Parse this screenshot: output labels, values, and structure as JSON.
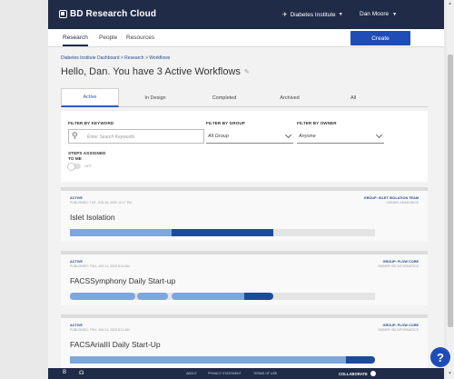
{
  "header": {
    "app_name": "BD Research Cloud",
    "org_name": "Diabetes Institute",
    "user_name": "Dan Moore"
  },
  "nav": {
    "items": [
      {
        "label": "Research"
      },
      {
        "label": "People"
      },
      {
        "label": "Resources"
      }
    ],
    "create_label": "Create"
  },
  "breadcrumb": "Diabetes Institute Dashboard  >  Research  >  Workflows",
  "headline": "Hello, Dan. You have 3 Active Workflows",
  "tabs": [
    {
      "label": "Active"
    },
    {
      "label": "In Design"
    },
    {
      "label": "Completed"
    },
    {
      "label": "Archived"
    },
    {
      "label": "All"
    }
  ],
  "filters": {
    "keyword_label": "FILTER BY KEYWORD",
    "keyword_placeholder": "Enter Search Keywords",
    "group_label": "FILTER BY GROUP",
    "group_value": "All Group",
    "owner_label": "FILTER BY OWNER",
    "owner_value": "Anyone",
    "steps_label_1": "STEPS ASSIGNED",
    "steps_label_2": "TO ME",
    "toggle_label": "OFF",
    "toggle_on": false
  },
  "workflows": [
    {
      "status": "ACTIVE",
      "published": "PUBLISHED: TUE, JUN 16, 2020 12:17 PM",
      "group": "GROUP: ISLET ISOLATION TEAM",
      "owner": "OWNER: ADAM BECK",
      "name": "Islet Isolation"
    },
    {
      "status": "ACTIVE",
      "published": "PUBLISHED: THU, JUN 11, 2020 8:44 AM",
      "group": "GROUP: FLOW CORE",
      "owner": "OWNER: BD INFORMATICS",
      "name": "FACSSymphony Daily Start-up"
    },
    {
      "status": "ACTIVE",
      "published": "PUBLISHED: THU, JUN 11, 2020 8:11 AM",
      "group": "GROUP: FLOW CORE",
      "owner": "OWNER: BD INFORMATICS",
      "name": "FACSAriaIII Daily Start-Up"
    }
  ],
  "footer": {
    "links": [
      {
        "label": "ABOUT"
      },
      {
        "label": "PRIVACY STATEMENT"
      },
      {
        "label": "TERMS OF USE"
      }
    ],
    "collaborate_label": "COLLABORATE"
  },
  "colors": {
    "header_bg": "#1f2b47",
    "accent": "#1f4db8",
    "progress_light": "#7da7dc",
    "progress_dark": "#1e4a9e",
    "progress_track": "#e4e4e4"
  }
}
